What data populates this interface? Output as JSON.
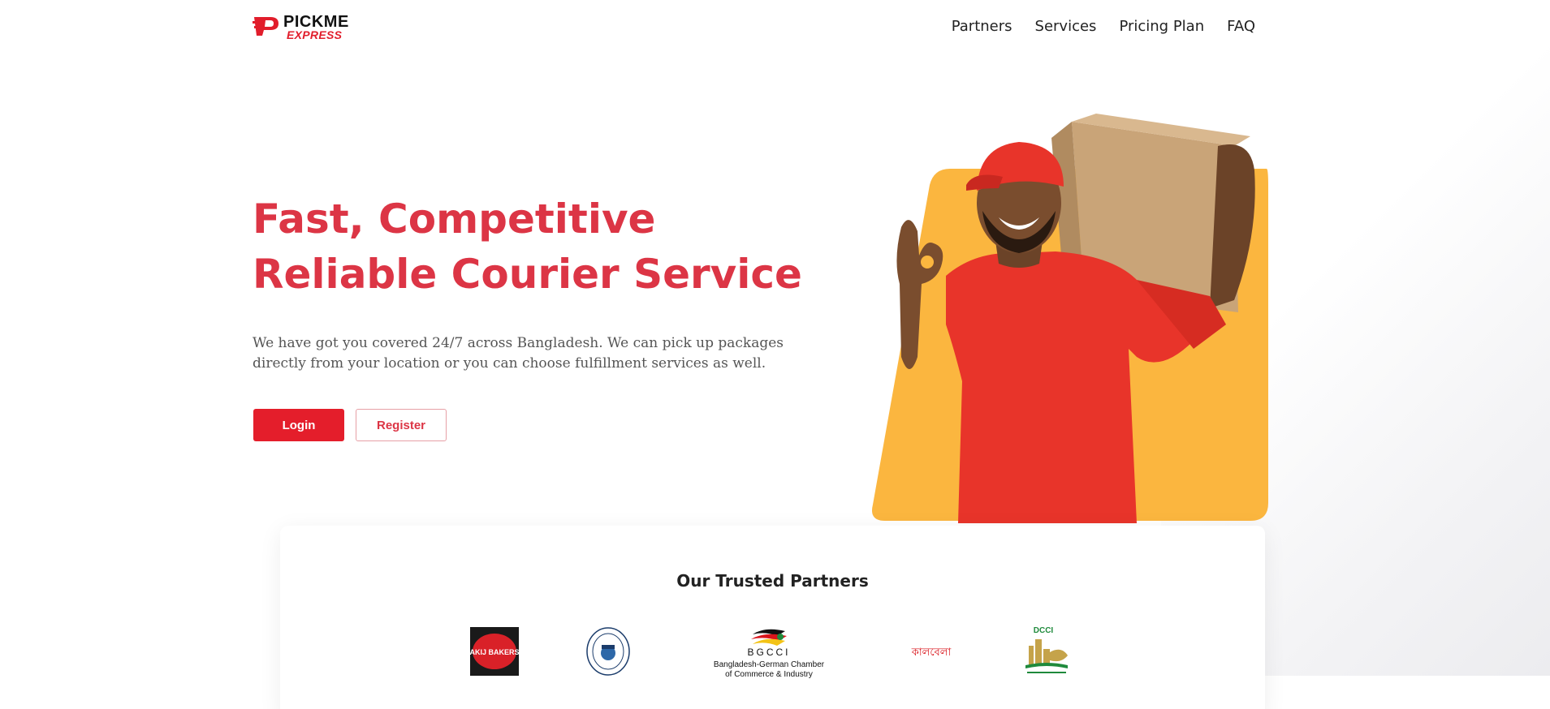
{
  "header": {
    "logo": {
      "brand": "PICKME",
      "sub": "EXPRESS"
    },
    "nav": [
      {
        "label": "Partners"
      },
      {
        "label": "Services"
      },
      {
        "label": "Pricing Plan"
      },
      {
        "label": "FAQ"
      }
    ]
  },
  "hero": {
    "title_line1": "Fast, Competitive",
    "title_line2": "Reliable Courier Service",
    "description": "We have got you covered 24/7 across Bangladesh. We can pick up packages directly from your location or you can choose fulfillment services as well.",
    "login_label": "Login",
    "register_label": "Register",
    "image": "courier-man-holding-box"
  },
  "partners": {
    "title": "Our Trusted Partners",
    "logos": [
      {
        "name": "akij-bakers-logo",
        "text": "AKIJ BAKERS"
      },
      {
        "name": "university-seal-logo"
      },
      {
        "name": "bgcci-logo",
        "abbr": "BGCCI",
        "text_line1": "Bangladesh-German Chamber",
        "text_line2": "of Commerce & Industry"
      },
      {
        "name": "bengali-wordmark-logo",
        "text": "কালবেলা"
      },
      {
        "name": "dcci-logo",
        "abbr": "DCCI"
      }
    ]
  },
  "colors": {
    "brand_red": "#dc3545",
    "button_red": "#e41e2b",
    "hero_accent": "#fbb63f"
  }
}
